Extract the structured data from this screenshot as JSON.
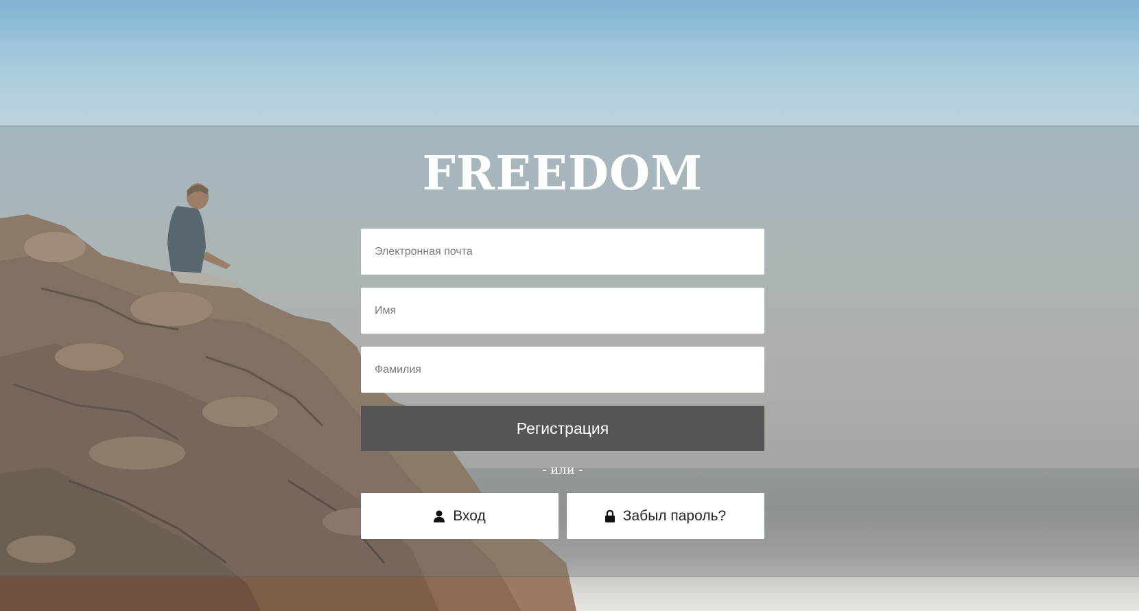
{
  "brand": {
    "title": "FREEDOM"
  },
  "form": {
    "email_placeholder": "Электронная почта",
    "first_name_placeholder": "Имя",
    "last_name_placeholder": "Фамилия",
    "register_label": "Регистрация",
    "separator": "- или -",
    "login_label": "Вход",
    "forgot_label": "Забыл пароль?"
  },
  "icons": {
    "login": "user-icon",
    "forgot": "lock-icon"
  },
  "colors": {
    "register_button": "#555555",
    "field_background": "#ffffff",
    "overlay": "rgba(110,120,125,0.32)"
  }
}
